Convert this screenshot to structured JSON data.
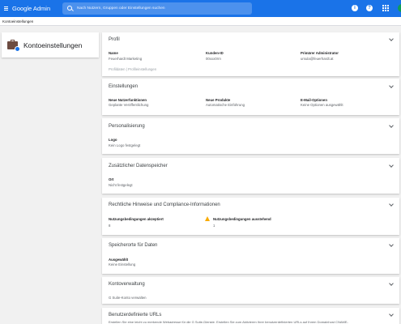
{
  "topbar": {
    "brand_google": "Google",
    "brand_admin": "Admin",
    "search_placeholder": "Nach Nutzern, Gruppen oder Einstellungen suchen",
    "help_label": "?",
    "info_label": "i"
  },
  "breadcrumb": "Kontoeinstellungen",
  "left": {
    "title": "Kontoeinstellungen"
  },
  "profil": {
    "header": "Profil",
    "name_label": "Name",
    "name_value": "Feuerhardt Marketing",
    "kunden_label": "Kunden-ID",
    "kunden_value": "00xxx0rrn",
    "admin_label": "Primärer Administrator",
    "admin_value": "ursula@feuerhardt.at",
    "footer_link": "Profildaten | Profileinstellungen"
  },
  "einstellungen": {
    "header": "Einstellungen",
    "nf_label": "Neue Nutzerfunktionen",
    "nf_value": "Geplante Veröffentlichung",
    "np_label": "Neue Produkte",
    "np_value": "Automatische Einführung",
    "em_label": "E-Mail-Optionen",
    "em_value": "Keine Optionen ausgewählt"
  },
  "personalisierung": {
    "header": "Personalisierung",
    "logo_label": "Logo",
    "logo_value": "Kein Logo festgelegt"
  },
  "speicher": {
    "header": "Zusätzlicher Datenspeicher",
    "ort_label": "Ort",
    "ort_value": "Nicht festgelegt"
  },
  "rechtliche": {
    "header": "Rechtliche Hinweise und Compliance-Informationen",
    "acc_label": "Nutzungsbedingungen akzeptiert",
    "acc_value": "8",
    "pend_label": "Nutzungsbedingungen ausstehend",
    "pend_value": "1"
  },
  "speicherorte": {
    "header": "Speicherorte für Daten",
    "sel_label": "Ausgewählt",
    "sel_value": "Keine Einstellung"
  },
  "kontoverwaltung": {
    "header": "Kontoverwaltung",
    "link": "G Suite-Konto verwalten"
  },
  "urls": {
    "header": "Benutzerdefinierte URLs",
    "desc": "Erstellen Sie eine leicht zu merkende Webadresse für die G Suite-Dienste. Erstellen Sie zum Aktivieren Ihrer benutzerdefinierten URLs auf Ihrem Domainhost CNAME-"
  },
  "colors": {
    "brand_blue": "#1a73e8",
    "warning": "#f9ab00"
  }
}
